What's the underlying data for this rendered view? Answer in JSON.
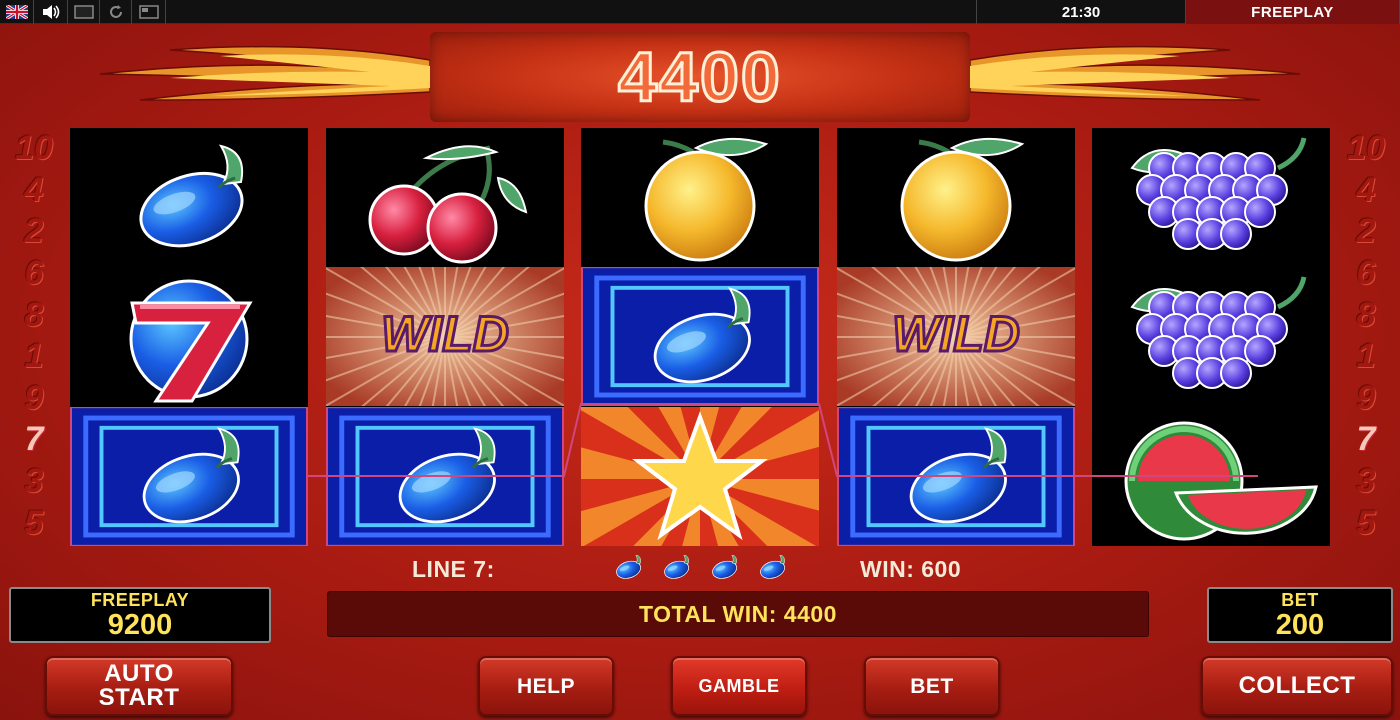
{
  "top_bar": {
    "flag_icon": "uk-flag-icon",
    "sound_icon": "speaker-icon",
    "screen_icon": "screen-icon",
    "reload_icon": "reload-icon",
    "window_icon": "window-icon",
    "clock": "21:30",
    "mode": "FREEPLAY"
  },
  "banner": {
    "win_value": "4400"
  },
  "paylines": {
    "left": [
      "10",
      "4",
      "2",
      "6",
      "8",
      "1",
      "9",
      "7",
      "3",
      "5"
    ],
    "right": [
      "10",
      "4",
      "2",
      "6",
      "8",
      "1",
      "9",
      "7",
      "3",
      "5"
    ],
    "active": "7"
  },
  "reels": [
    [
      "plum",
      "seven",
      "plum"
    ],
    [
      "cherries",
      "wild",
      "plum"
    ],
    [
      "orange",
      "plum",
      "star"
    ],
    [
      "orange",
      "wild",
      "plum"
    ],
    [
      "grapes",
      "grapes",
      "watermelon"
    ]
  ],
  "win_info": {
    "line_label": "LINE 7:",
    "symbol_icon": "plum-icon",
    "symbol_count": 4,
    "win_label": "WIN: 600",
    "total_win": "TOTAL WIN: 4400"
  },
  "credits": {
    "freeplay_label": "FREEPLAY",
    "freeplay_value": "9200",
    "bet_label": "BET",
    "bet_value": "200"
  },
  "buttons": {
    "auto_line1": "AUTO",
    "auto_line2": "START",
    "help": "HELP",
    "gamble": "GAMBLE",
    "bet": "BET",
    "collect": "COLLECT"
  },
  "colors": {
    "panel_red": "#a91b12",
    "banner_digits": "#f36a3a",
    "credit_yellow": "#ffe35a",
    "win_frame": "#d1477d"
  }
}
